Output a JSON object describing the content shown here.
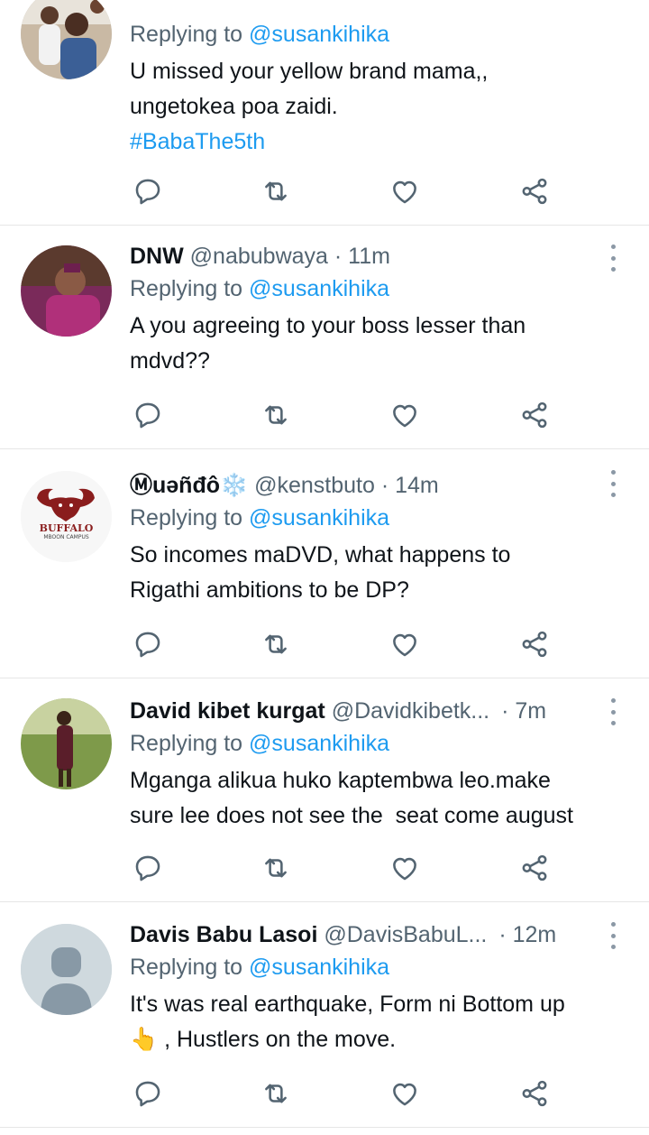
{
  "colors": {
    "link": "#1d9bf0",
    "secondary": "#536471",
    "divider": "#e6e6e6"
  },
  "icons": {
    "reply": "reply-icon",
    "retweet": "retweet-icon",
    "like": "heart-icon",
    "share": "share-icon",
    "more": "more-options-icon"
  },
  "tweets": [
    {
      "replying_prefix": "Replying to ",
      "replying_to": "@susankihika",
      "text_line1": "U missed your yellow brand mama,,",
      "text_line2": "ungetokea poa zaidi.",
      "hashtag": "#BabaThe5th"
    },
    {
      "name": "DNW",
      "handle": "@nabubwaya",
      "dot": "·",
      "time": "11m",
      "replying_prefix": "Replying to ",
      "replying_to": "@susankihika",
      "text_line1": "A you agreeing to your boss lesser than",
      "text_line2": "mdvd??"
    },
    {
      "name": "Ⓜuəñđô❄️",
      "handle": "@kenstbuto",
      "dot": "·",
      "time": "14m",
      "replying_prefix": "Replying to ",
      "replying_to": "@susankihika",
      "text_line1": "So incomes maDVD, what happens to",
      "text_line2": "Rigathi ambitions to be DP?",
      "avatar_logo_line1": "BUFFALO",
      "avatar_logo_line2": "MBOON CAMPUS"
    },
    {
      "name": "David kibet kurgat",
      "handle": "@Davidkibetk...",
      "dot": "·",
      "time": "7m",
      "replying_prefix": "Replying to ",
      "replying_to": "@susankihika",
      "text_line1": "Mganga alikua huko kaptembwa leo.make",
      "text_line2": "sure lee does not see the  seat come august"
    },
    {
      "name": "Davis Babu Lasoi",
      "handle": "@DavisBabuL...",
      "dot": "·",
      "time": "12m",
      "replying_prefix": "Replying to ",
      "replying_to": "@susankihika",
      "text_line1": "It's was real earthquake, Form ni Bottom up",
      "text_line2": "👆 , Hustlers on the move."
    }
  ]
}
